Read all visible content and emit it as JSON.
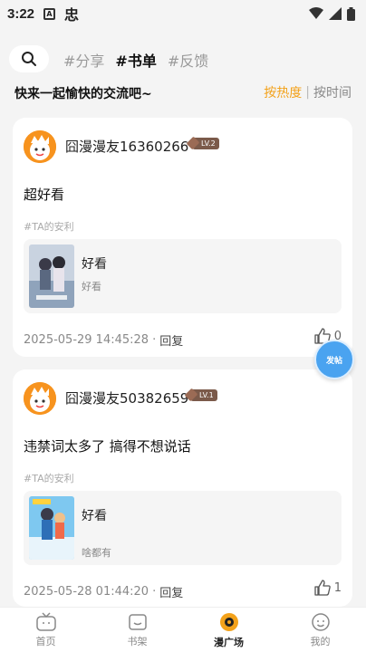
{
  "status_bar": {
    "time": "3:22",
    "icon_a": "A",
    "icon_b": "忠"
  },
  "header": {
    "tags": [
      "#分享",
      "#书单",
      "#反馈"
    ],
    "active_tag_index": 1,
    "subtitle": "快来一起愉快的交流吧~",
    "sort_active": "按热度",
    "sort_separator": "|",
    "sort_inactive": "按时间"
  },
  "posts": [
    {
      "username": "囧漫漫友16360266",
      "level": "LV.2",
      "text": "超好看",
      "tag": "#TA的安利",
      "item_title": "好看",
      "item_desc": "好看",
      "date": "2025-05-29 14:45:28",
      "dot": "·",
      "reply": "回复",
      "likes": "0"
    },
    {
      "username": "囧漫漫友50382659",
      "level": "LV.1",
      "text": "违禁词太多了 搞得不想说话",
      "tag": "#TA的安利",
      "item_title": "好看",
      "item_desc": "啥都有",
      "date": "2025-05-28 01:44:20",
      "dot": "·",
      "reply": "回复",
      "likes": "1"
    }
  ],
  "float_button": {
    "label": "发帖"
  },
  "bottom_nav": [
    {
      "label": "首页",
      "icon": "tv-icon"
    },
    {
      "label": "书架",
      "icon": "bookshelf-icon"
    },
    {
      "label": "漫广场",
      "icon": "plaza-icon",
      "active": true
    },
    {
      "label": "我的",
      "icon": "profile-icon"
    }
  ],
  "colors": {
    "accent": "#f3a21b",
    "float_button": "#4aa3f0",
    "level_badge": "#7b5a4a"
  }
}
